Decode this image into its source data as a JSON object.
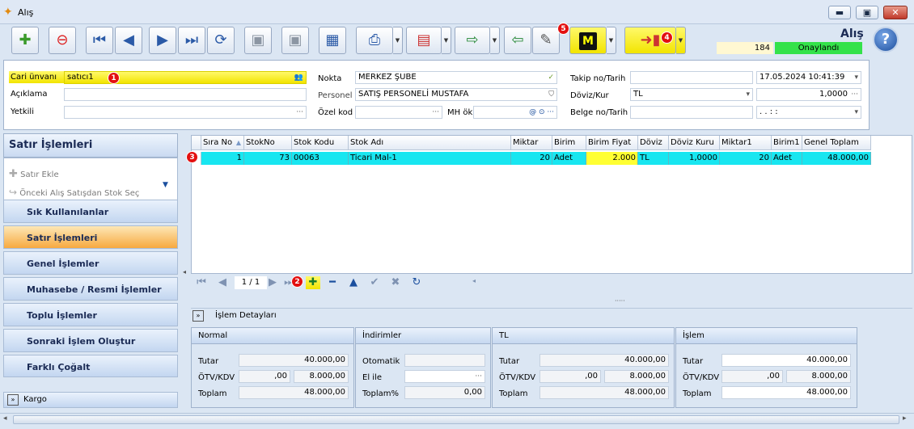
{
  "window": {
    "title": "Alış",
    "controls": {
      "minimize": "▬",
      "maximize": "▣",
      "close": "✕"
    }
  },
  "toolbar": {
    "doc_title": "Alış",
    "doc_number": "184",
    "doc_status": "Onaylandı",
    "status_color": "#34e24a",
    "highlight_color": "#fff200",
    "badge_color": "#e31010",
    "badges": {
      "header": "1",
      "grid_add": "2",
      "row": "3",
      "exit": "4",
      "tools": "5"
    },
    "m_label": "M"
  },
  "header": {
    "cari_unvani_label": "Cari ünvanı",
    "cari_unvani_value": "satıcı1",
    "aciklama_label": "Açıklama",
    "aciklama_value": "",
    "yetkili_label": "Yetkili",
    "yetkili_value": "",
    "ellipsis": "···",
    "nokta_label": "Nokta",
    "nokta_value": "MERKEZ ŞUBE",
    "personel_label": "Personel",
    "personel_value": "SATIŞ PERSONELİ MUSTAFA",
    "ozel_kod_label": "Özel kod",
    "ozel_kod_value": "",
    "mh_ok_label": "MH ök",
    "mh_ok_value": "",
    "takip_label": "Takip no/Tarih",
    "takip_value": "",
    "takip_date": "17.05.2024 10:41:39",
    "doviz_kur_label": "Döviz/Kur",
    "doviz_value": "TL",
    "kur_value": "1,0000",
    "belge_label": "Belge no/Tarih",
    "belge_value": "",
    "belge_date": ". .     :  :"
  },
  "left_panel": {
    "header": "Satır İşlemleri",
    "actions": [
      {
        "label": "Satır Ekle"
      },
      {
        "label": "Önceki Alış Satışdan Stok Seç"
      }
    ],
    "nav": [
      {
        "label": "Sık Kullanılanlar"
      },
      {
        "label": "Satır İşlemleri"
      },
      {
        "label": "Genel İşlemler"
      },
      {
        "label": "Muhasebe / Resmi İşlemler"
      },
      {
        "label": "Toplu İşlemler"
      },
      {
        "label": "Sonraki İşlem Oluştur"
      },
      {
        "label": "Farklı Çoğalt"
      }
    ],
    "cargo": "Kargo"
  },
  "grid": {
    "columns": [
      "Sıra No",
      "StokNo",
      "Stok Kodu",
      "Stok Adı",
      "Miktar",
      "Birim",
      "Birim Fiyat",
      "Döviz",
      "Döviz Kuru",
      "Miktar1",
      "Birim1",
      "Genel Toplam"
    ],
    "rows": [
      [
        "1",
        "73",
        "00063",
        "Ticari  Mal-1",
        "20",
        "Adet",
        "2.000",
        "TL",
        "1,0000",
        "20",
        "Adet",
        "48.000,00"
      ]
    ],
    "pager": "1 / 1"
  },
  "details": {
    "title": "İşlem Detayları",
    "normal": {
      "title": "Normal",
      "tutar_label": "Tutar",
      "tutar": "40.000,00",
      "otv_label": "ÖTV/KDV",
      "otv": ",00",
      "kdv": "8.000,00",
      "toplam_label": "Toplam",
      "toplam": "48.000,00"
    },
    "indirimler": {
      "title": "İndirimler",
      "otomatik_label": "Otomatik",
      "otomatik": "",
      "elile_label": "El ile",
      "elile": "",
      "toplam_pct_label": "Toplam%",
      "toplam_pct": "0,00"
    },
    "tl": {
      "title": "TL",
      "tutar_label": "Tutar",
      "tutar": "40.000,00",
      "otv_label": "ÖTV/KDV",
      "otv": ",00",
      "kdv": "8.000,00",
      "toplam_label": "Toplam",
      "toplam": "48.000,00"
    },
    "islem": {
      "title": "İşlem",
      "tutar_label": "Tutar",
      "tutar": "40.000,00",
      "otv_label": "ÖTV/KDV",
      "otv": ",00",
      "kdv": "8.000,00",
      "toplam_label": "Toplam",
      "toplam": "48.000,00"
    }
  }
}
